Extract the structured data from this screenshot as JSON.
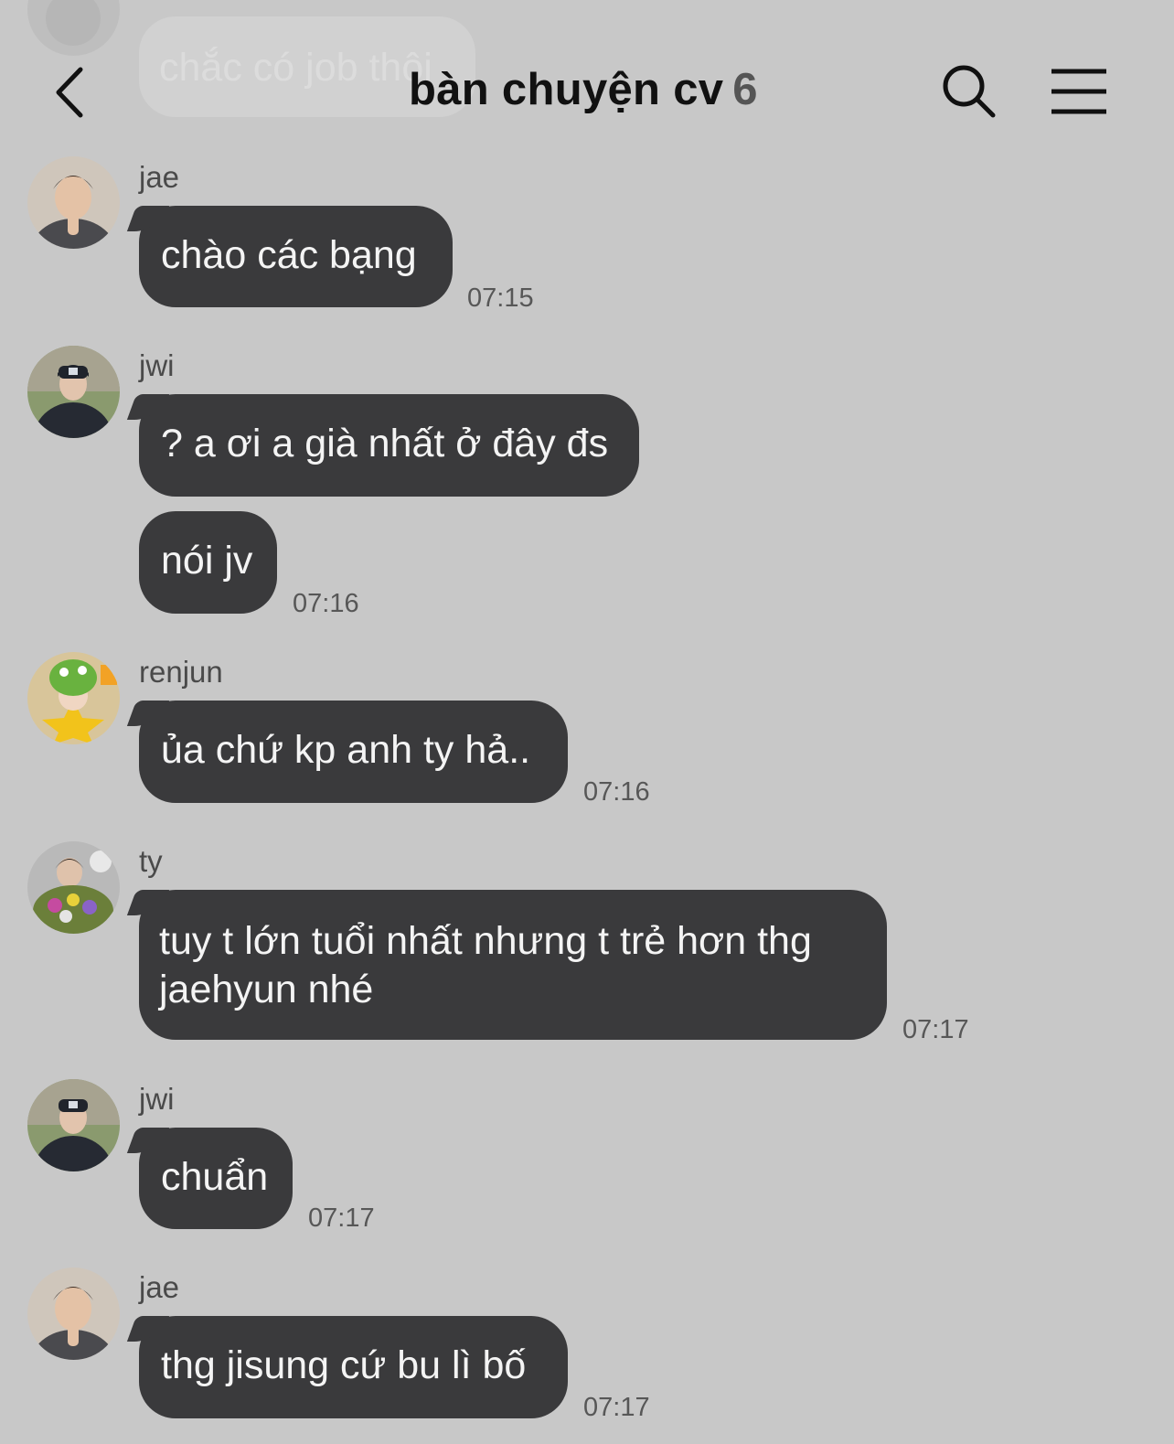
{
  "header": {
    "title": "bàn chuyện cv",
    "member_count": "6",
    "icons": [
      "chevron-left-icon",
      "search-icon",
      "hamburger-menu-icon"
    ]
  },
  "ghost_message": {
    "text": "chắc có job thôi"
  },
  "messages": [
    {
      "sender": "jae",
      "bubbles": [
        "chào các bạng"
      ],
      "time": "07:15"
    },
    {
      "sender": "jwi",
      "bubbles": [
        "? a ơi a già nhất ở đây đs",
        "nói jv"
      ],
      "time": "07:16"
    },
    {
      "sender": "renjun",
      "bubbles": [
        "ủa chứ kp anh ty hả.."
      ],
      "time": "07:16"
    },
    {
      "sender": "ty",
      "bubbles": [
        "tuy t lớn tuổi nhất nhưng t trẻ hơn thg",
        "jaehyun nhé"
      ],
      "time": "07:17"
    },
    {
      "sender": "jwi",
      "bubbles": [
        "chuẩn"
      ],
      "time": "07:17"
    },
    {
      "sender": "jae",
      "bubbles": [
        "thg jisung cứ bu lì bố"
      ],
      "time": "07:17"
    }
  ],
  "colors": {
    "background": "#c8c8c8",
    "bubble": "#3a3a3c",
    "bubble_text": "#f4f4f4",
    "timestamp": "#575757"
  }
}
